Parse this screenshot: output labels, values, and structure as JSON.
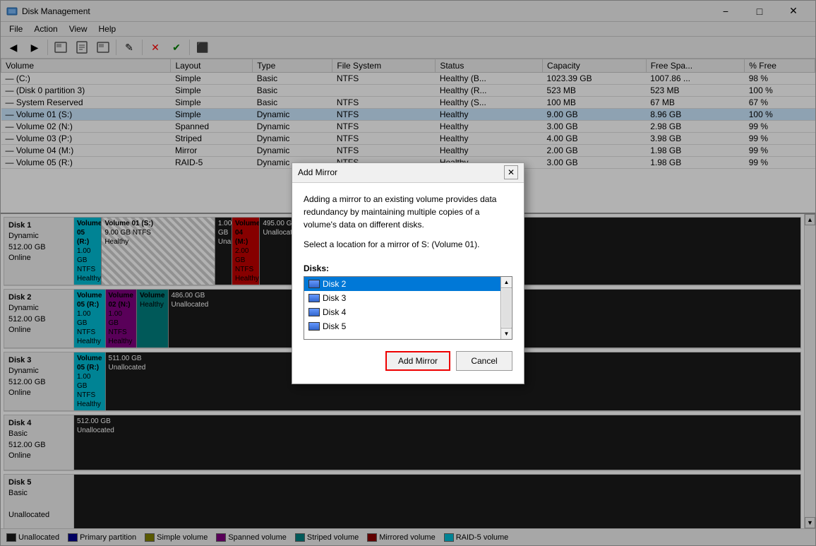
{
  "window": {
    "title": "Disk Management",
    "minimize_label": "−",
    "maximize_label": "□",
    "close_label": "✕"
  },
  "menu": {
    "items": [
      "File",
      "Action",
      "View",
      "Help"
    ]
  },
  "toolbar": {
    "buttons": [
      "◀",
      "▶",
      "⬛",
      "📋",
      "⬛",
      "✎",
      "⬛",
      "✕",
      "✔",
      "⬛"
    ]
  },
  "table": {
    "columns": [
      "Volume",
      "Layout",
      "Type",
      "File System",
      "Status",
      "Capacity",
      "Free Spa...",
      "% Free"
    ],
    "rows": [
      [
        "— (C:)",
        "Simple",
        "Basic",
        "NTFS",
        "Healthy (B...",
        "1023.39 GB",
        "1007.86 ...",
        "98 %"
      ],
      [
        "— (Disk 0 partition 3)",
        "Simple",
        "Basic",
        "",
        "Healthy (R...",
        "523 MB",
        "523 MB",
        "100 %"
      ],
      [
        "— System Reserved",
        "Simple",
        "Basic",
        "NTFS",
        "Healthy (S...",
        "100 MB",
        "67 MB",
        "67 %"
      ],
      [
        "— Volume 01 (S:)",
        "Simple",
        "Dynamic",
        "NTFS",
        "Healthy",
        "9.00 GB",
        "8.96 GB",
        "100 %"
      ],
      [
        "— Volume 02 (N:)",
        "Spanned",
        "Dynamic",
        "NTFS",
        "Healthy",
        "3.00 GB",
        "2.98 GB",
        "99 %"
      ],
      [
        "— Volume 03 (P:)",
        "Striped",
        "Dynamic",
        "NTFS",
        "Healthy",
        "4.00 GB",
        "3.98 GB",
        "99 %"
      ],
      [
        "— Volume 04 (M:)",
        "Mirror",
        "Dynamic",
        "NTFS",
        "Healthy",
        "2.00 GB",
        "1.98 GB",
        "99 %"
      ],
      [
        "— Volume 05 (R:)",
        "RAID-5",
        "Dynamic",
        "NTFS",
        "Healthy",
        "3.00 GB",
        "1.98 GB",
        "99 %"
      ]
    ]
  },
  "disks": [
    {
      "label": "Disk 1",
      "sublabel": "Dynamic",
      "size": "512.00 GB",
      "status": "Online",
      "volumes": [
        {
          "name": "Volume 05  (R:)",
          "size": "1.00 GB NTFS",
          "status": "Healthy",
          "color": "cyan",
          "flex": 2
        },
        {
          "name": "Volume 01 (S:)",
          "size": "9.00 GB NTFS",
          "status": "Healthy",
          "color": "hatched",
          "flex": 10
        },
        {
          "name": "",
          "size": "1.00 GB",
          "status": "Unallocated",
          "color": "unalloc",
          "flex": 1
        },
        {
          "name": "Volume 04 (M:)",
          "size": "2.00 GB NTFS",
          "status": "Healthy",
          "color": "darkred",
          "flex": 2
        },
        {
          "name": "",
          "size": "495.00 GB",
          "status": "Unallocated",
          "color": "unalloc",
          "flex": 50
        }
      ]
    },
    {
      "label": "Disk 2",
      "sublabel": "Dynamic",
      "size": "512.00 GB",
      "status": "Online",
      "volumes": [
        {
          "name": "Volume 05  (R:)",
          "size": "1.00 GB NTFS",
          "status": "Healthy",
          "color": "cyan",
          "flex": 2
        },
        {
          "name": "Volume 02 (N:)",
          "size": "1.00 GB NTFS",
          "status": "Healthy",
          "color": "purple",
          "flex": 2
        },
        {
          "name": "Volume",
          "size": "",
          "status": "Healthy",
          "color": "teal",
          "flex": 2
        },
        {
          "name": "",
          "size": "486.00 GB",
          "status": "Unallocated",
          "color": "unalloc",
          "flex": 50
        }
      ]
    },
    {
      "label": "Disk 3",
      "sublabel": "Dynamic",
      "size": "512.00 GB",
      "status": "Online",
      "volumes": [
        {
          "name": "Volume 05  (R:)",
          "size": "1.00 GB NTFS",
          "status": "Healthy",
          "color": "cyan",
          "flex": 2
        },
        {
          "name": "",
          "size": "511.00 GB",
          "status": "Unallocated",
          "color": "unalloc",
          "flex": 55
        }
      ]
    },
    {
      "label": "Disk 4",
      "sublabel": "Basic",
      "size": "512.00 GB",
      "status": "Online",
      "volumes": [
        {
          "name": "",
          "size": "512.00 GB",
          "status": "Unallocated",
          "color": "unalloc",
          "flex": 60
        }
      ]
    },
    {
      "label": "Disk 5",
      "sublabel": "Basic",
      "size": "",
      "status": "Unallocated",
      "volumes": []
    }
  ],
  "legend": {
    "items": [
      {
        "label": "Unallocated",
        "color": "#1a1a1a"
      },
      {
        "label": "Primary partition",
        "color": "#00008b"
      },
      {
        "label": "Simple volume",
        "color": "#808000"
      },
      {
        "label": "Spanned volume",
        "color": "#800080"
      },
      {
        "label": "Striped volume",
        "color": "#008080"
      },
      {
        "label": "Mirrored volume",
        "color": "#8b0000"
      },
      {
        "label": "RAID-5 volume",
        "color": "#00bcd4"
      }
    ]
  },
  "dialog": {
    "title": "Add Mirror",
    "close_label": "✕",
    "description": "Adding a mirror to an existing volume provides data redundancy by maintaining multiple copies of a volume's data on different disks.",
    "select_label": "Select a location for a mirror of S: (Volume 01).",
    "disks_label": "Disks:",
    "disks": [
      {
        "label": "Disk 2",
        "selected": true
      },
      {
        "label": "Disk 3",
        "selected": false
      },
      {
        "label": "Disk 4",
        "selected": false
      },
      {
        "label": "Disk 5",
        "selected": false
      }
    ],
    "add_mirror_label": "Add Mirror",
    "cancel_label": "Cancel"
  }
}
